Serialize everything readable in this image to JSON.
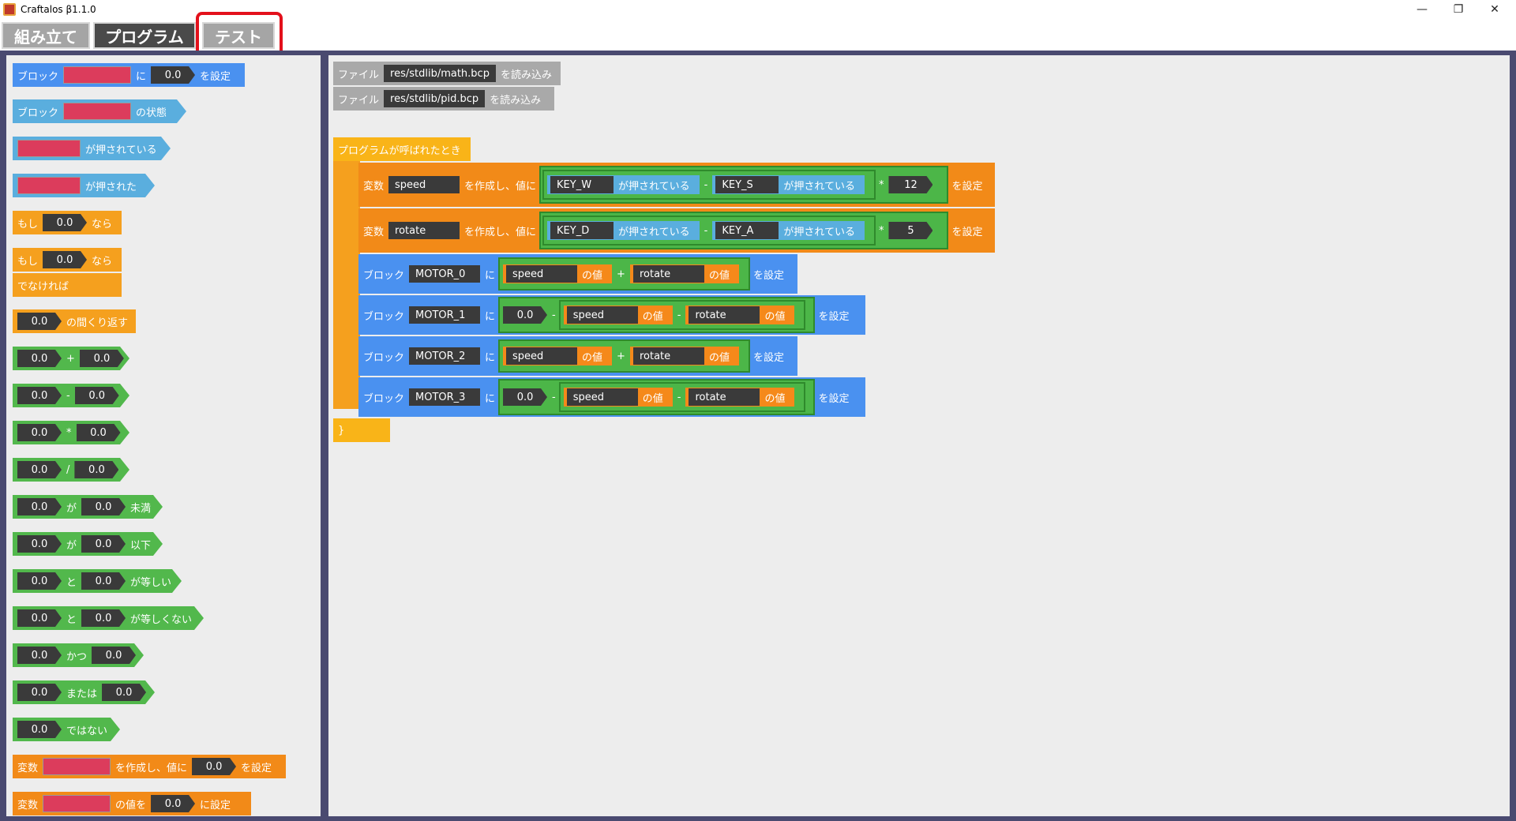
{
  "window": {
    "title": "Craftalos β1.1.0",
    "min": "—",
    "max": "❐",
    "close": "✕"
  },
  "tabs": [
    {
      "label": "組み立て"
    },
    {
      "label": "プログラム"
    },
    {
      "label": "テスト"
    }
  ],
  "palette": {
    "block_label": "ブロック",
    "ni": "に",
    "set": "を設定",
    "state": "の状態",
    "pressed": "が押されている",
    "was_pressed": "が押された",
    "if": "もし",
    "then": "なら",
    "else": "でなければ",
    "repeat": "の間くり返す",
    "zero": "0.0",
    "plus": "+",
    "minus": "-",
    "times": "*",
    "div": "/",
    "ga": "が",
    "lt": "未満",
    "le": "以下",
    "to": "と",
    "eq": "が等しい",
    "neq": "が等しくない",
    "and": "かつ",
    "or": "または",
    "not": "ではない",
    "var": "変数",
    "create_with": "を作成し、値に",
    "value_of": "の値を",
    "set_to": "に設定"
  },
  "editor": {
    "file_label": "ファイル",
    "load": "を読み込み",
    "files": [
      "res/stdlib/math.bcp",
      "res/stdlib/pid.bcp"
    ],
    "on_call": "プログラムが呼ばれたとき",
    "var": "変数",
    "create_with": "を作成し、値に",
    "pressed": "が押されている",
    "set": "を設定",
    "block": "ブロック",
    "ni": "に",
    "value": "の値",
    "minus": "-",
    "plus": "+",
    "times": "*",
    "zero": "0.0",
    "close_brace": "}",
    "var1": {
      "name": "speed",
      "k1": "KEY_W",
      "k2": "KEY_S",
      "mult": "12"
    },
    "var2": {
      "name": "rotate",
      "k1": "KEY_D",
      "k2": "KEY_A",
      "mult": "5"
    },
    "motors": [
      "MOTOR_0",
      "MOTOR_1",
      "MOTOR_2",
      "MOTOR_3"
    ],
    "speed": "speed",
    "rotate": "rotate"
  }
}
